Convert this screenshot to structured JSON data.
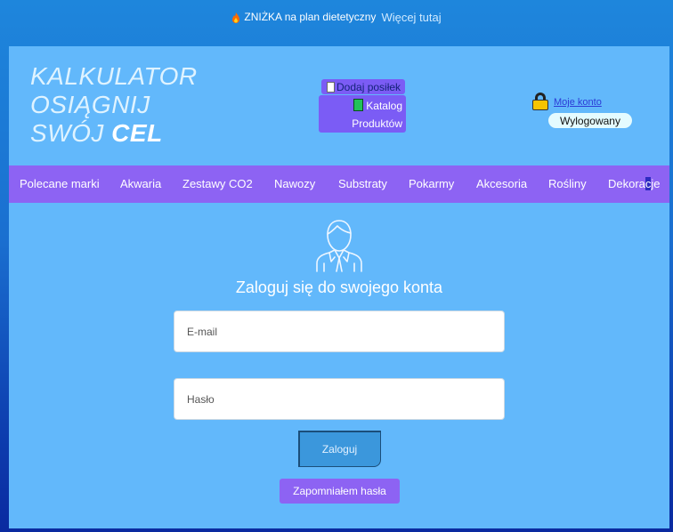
{
  "promo": {
    "text": "ZNIŻKA na plan dietetyczny",
    "link": "Więcej tutaj",
    "icon": "fire-icon"
  },
  "logo": {
    "line1": "KALKULATOR",
    "line2": "OSIĄGNIJ",
    "line3_prefix": "SWÓJ ",
    "line3_bold": "CEL"
  },
  "header_buttons": {
    "add_meal": "Dodaj posiłek",
    "catalog_line1": "Katalog",
    "catalog_line2": "Produktów"
  },
  "account": {
    "link": "Moje konto",
    "status": "Wylogowany",
    "icon": "lock-icon"
  },
  "nav": {
    "items": [
      "Polecane marki",
      "Akwaria",
      "Zestawy CO2",
      "Nawozy",
      "Substraty",
      "Pokarmy",
      "Akcesoria",
      "Rośliny"
    ],
    "last_prefix": "Dekora",
    "last_highlight": "c",
    "last_suffix": "je"
  },
  "login": {
    "title": "Zaloguj się do swojego konta",
    "email_placeholder": "E-mail",
    "password_placeholder": "Hasło",
    "submit": "Zaloguj",
    "forgot": "Zapomniałem hasła"
  },
  "colors": {
    "panel": "#62b8fb",
    "accent_purple": "#8d63f3",
    "nav_highlight": "#2d2bc0"
  }
}
